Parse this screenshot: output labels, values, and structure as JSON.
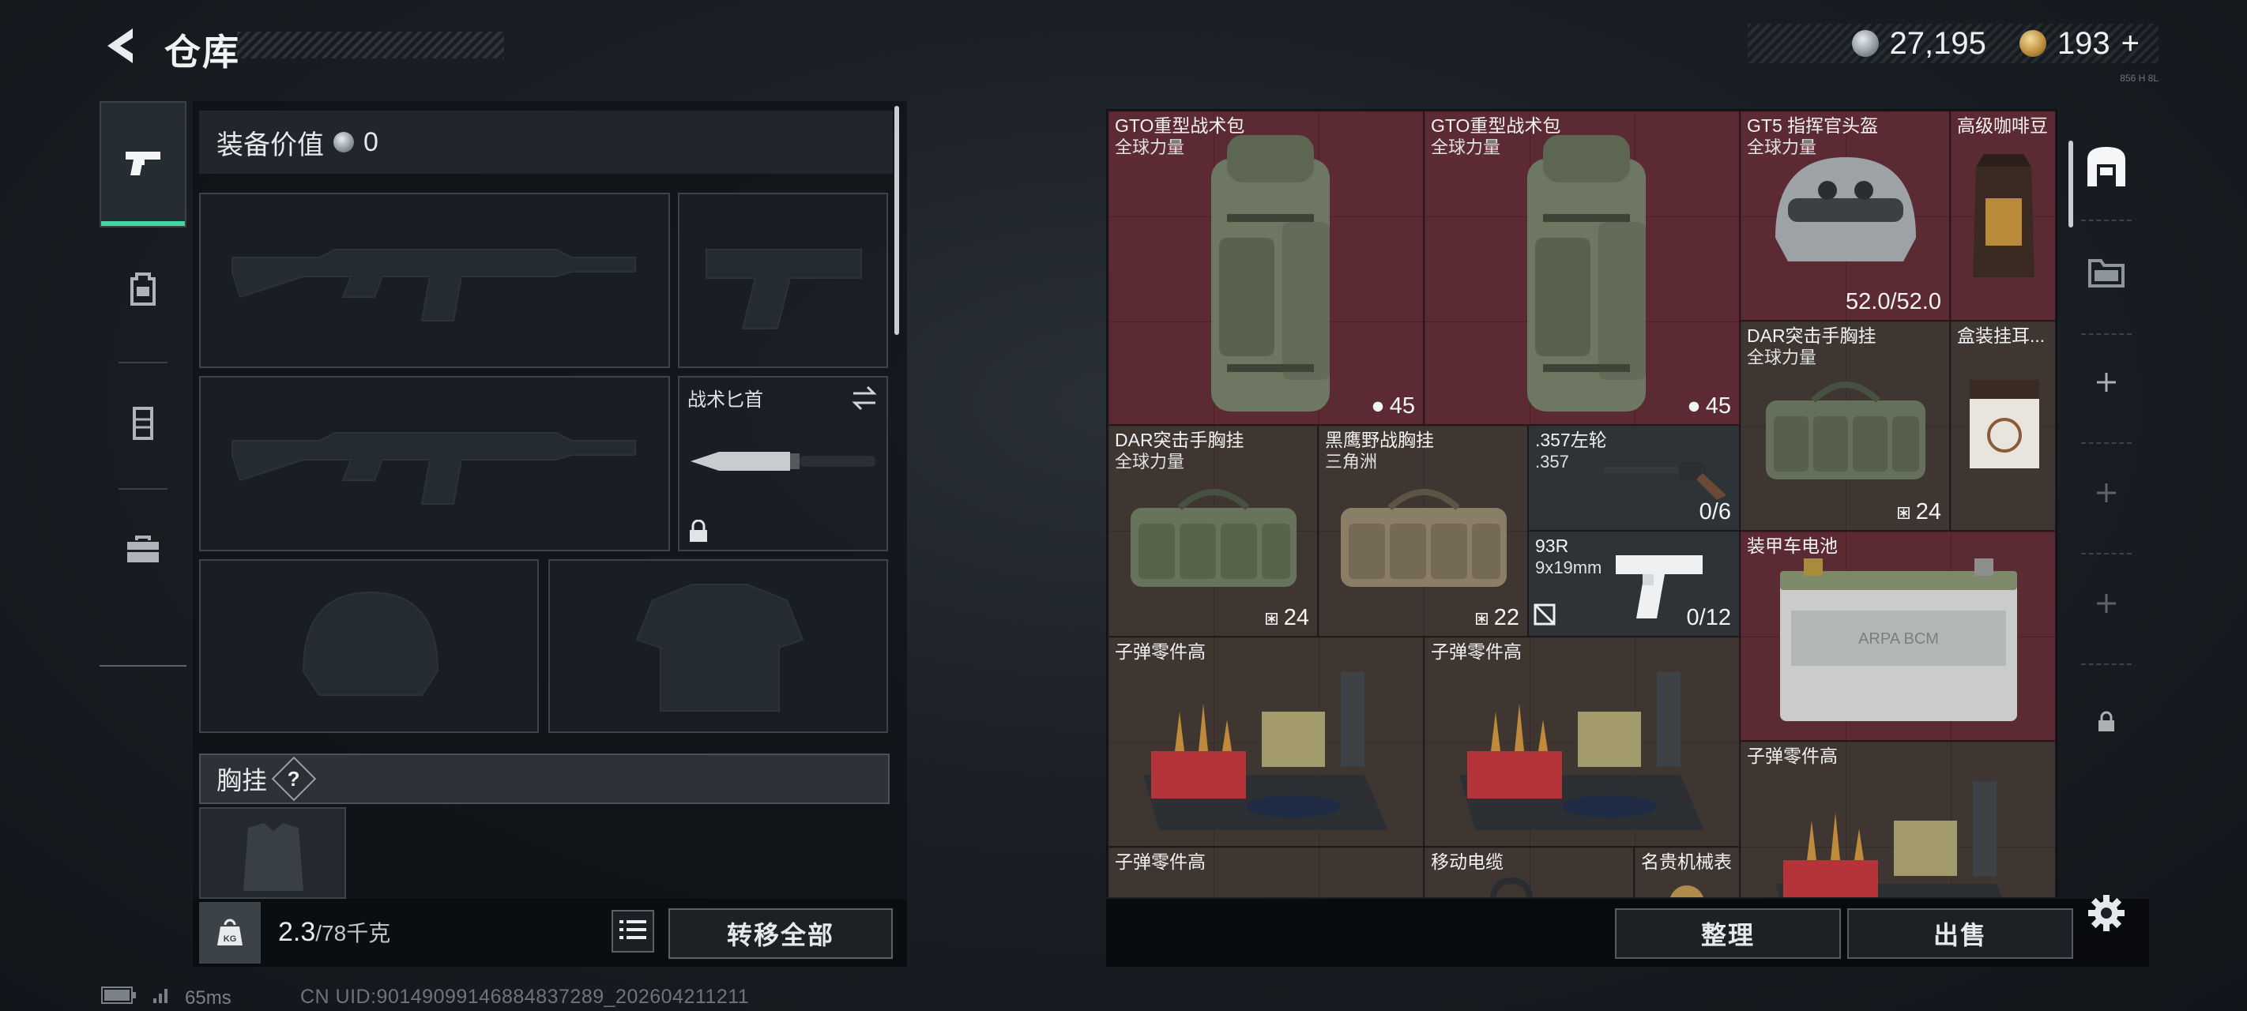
{
  "header": {
    "title": "仓库",
    "currency_silver": "27,195",
    "currency_gold": "193",
    "currency_add": "+",
    "tiny_code": "856 H 8L"
  },
  "tabs": [
    {
      "icon": "pistol-icon"
    },
    {
      "icon": "backpack-icon"
    },
    {
      "icon": "vest-icon"
    },
    {
      "icon": "toolbox-icon"
    }
  ],
  "loadout": {
    "equipment_value_label": "装备价值",
    "equipment_value": "0",
    "melee_slot_name": "战术匕首",
    "chest_rig_label": "胸挂",
    "chest_rig_help": "?",
    "weight_current": "2.3",
    "weight_max": "/78千克",
    "kg_label": "KG",
    "transfer_all": "转移全部"
  },
  "storage": {
    "items": [
      {
        "name": "GTO重型战术包",
        "sub": "全球力量",
        "count": "45"
      },
      {
        "name": "GTO重型战术包",
        "sub": "全球力量",
        "count": "45"
      },
      {
        "name": "GT5 指挥官头盔",
        "sub": "全球力量",
        "durability": "52.0/52.0"
      },
      {
        "name": "高级咖啡豆"
      },
      {
        "name": "DAR突击手胸挂",
        "sub": "全球力量",
        "count": "24"
      },
      {
        "name": "盒装挂耳..."
      },
      {
        "name": "DAR突击手胸挂",
        "sub": "全球力量",
        "count": "24"
      },
      {
        "name": "黑鹰野战胸挂",
        "sub": "三角洲",
        "count": "22"
      },
      {
        "name": ".357左轮",
        "sub": ".357",
        "ammo": "0/6"
      },
      {
        "name": "93R",
        "sub": "9x19mm",
        "ammo": "0/12"
      },
      {
        "name": "装甲车电池",
        "art_text": "ARPA BCM"
      },
      {
        "name": "子弹零件高"
      },
      {
        "name": "子弹零件高"
      },
      {
        "name": "子弹零件高"
      },
      {
        "name": "子弹零件高"
      },
      {
        "name": "移动电缆"
      },
      {
        "name": "名贵机械表"
      }
    ],
    "sort_label": "整理",
    "sell_label": "出售"
  },
  "status": {
    "ping": "65ms",
    "uid": "CN UID:90149099146884837289_202604211211"
  },
  "colors": {
    "accent_green": "#3fd8a0",
    "rare_red": "#5c2a33",
    "common_brown": "#3f3631"
  }
}
